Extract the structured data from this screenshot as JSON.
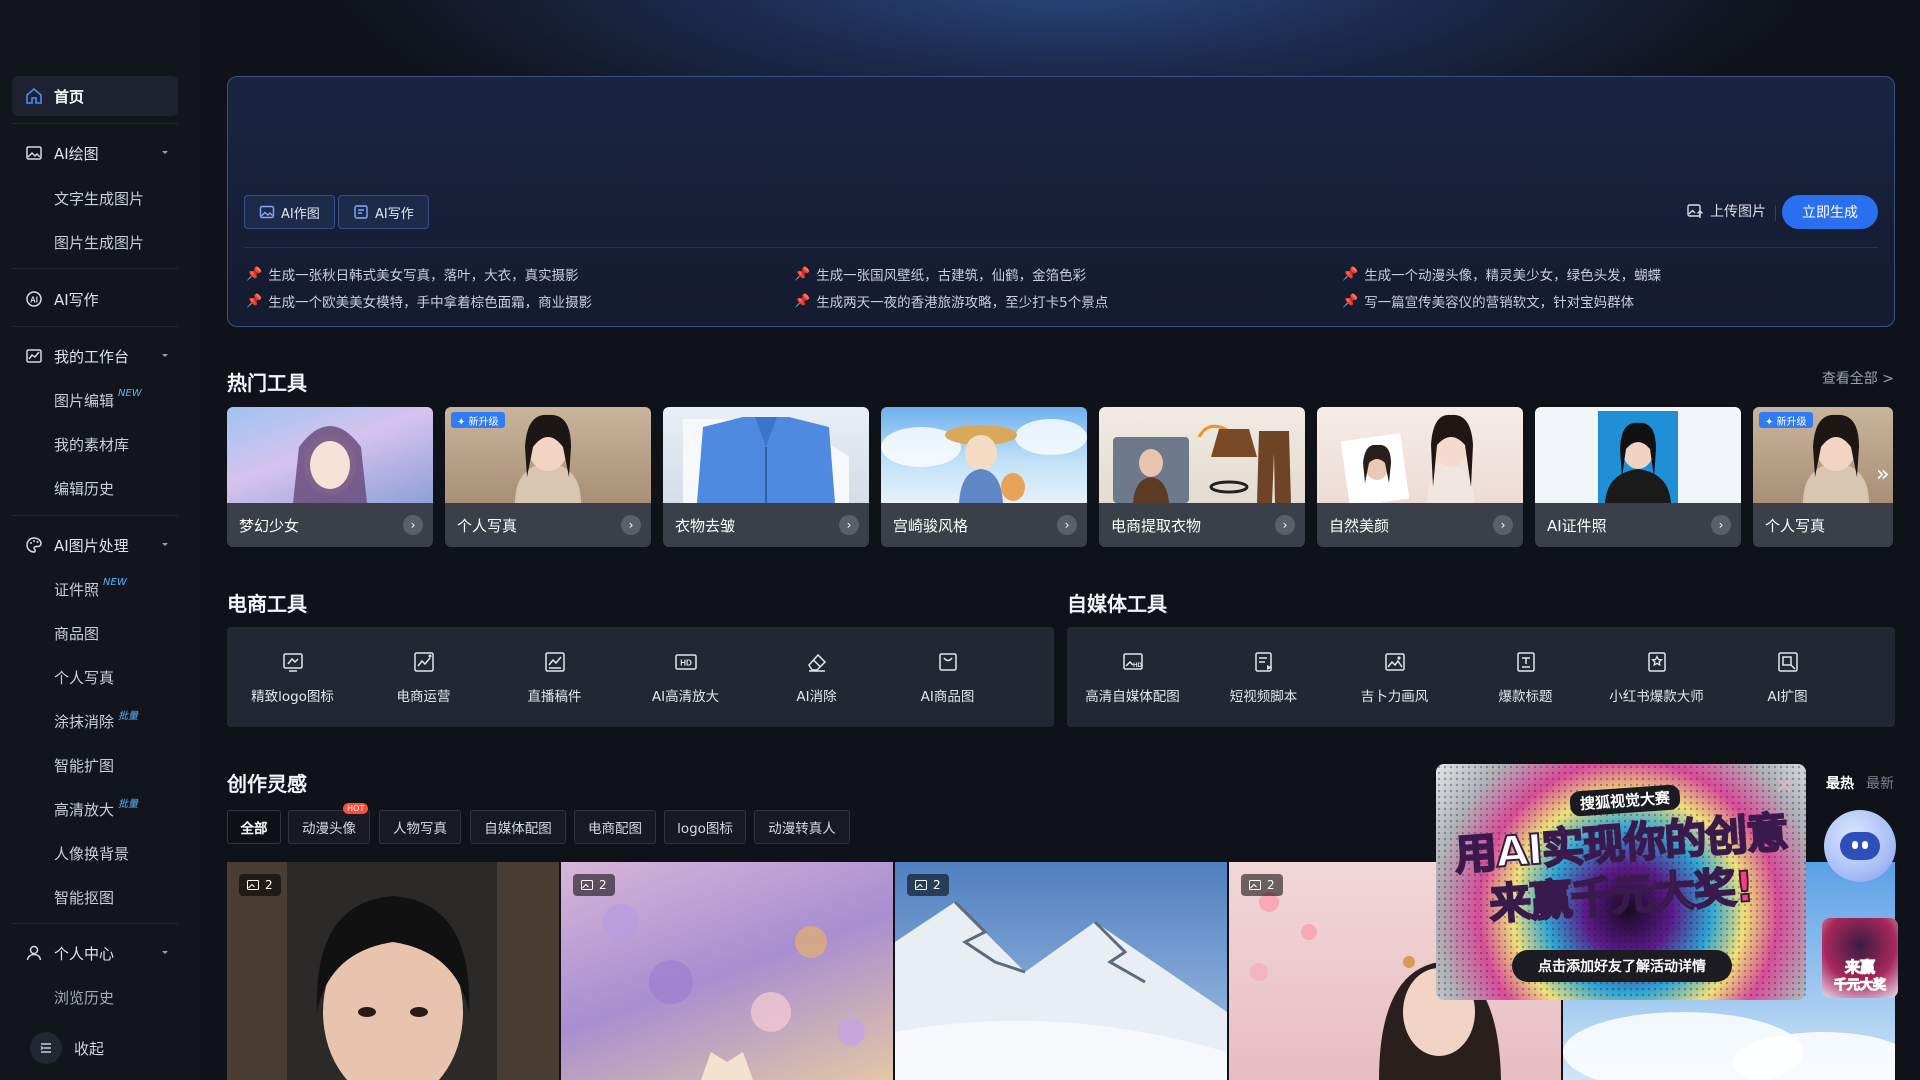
{
  "sidebar": {
    "home": "首页",
    "ai_draw": "AI绘图",
    "ai_draw_items": [
      "文字生成图片",
      "图片生成图片"
    ],
    "ai_write": "AI写作",
    "workbench": "我的工作台",
    "workbench_items": [
      "图片编辑",
      "我的素材库",
      "编辑历史"
    ],
    "image_edit_badge": "NEW",
    "ai_image_process": "AI图片处理",
    "process_items": [
      "证件照",
      "商品图",
      "个人写真",
      "涂抹消除",
      "智能扩图",
      "高清放大",
      "人像换背景",
      "智能抠图"
    ],
    "id_photo_badge": "NEW",
    "erase_badge": "批量",
    "upscale_badge": "批量",
    "personal_center": "个人中心",
    "browse_history": "浏览历史",
    "collapse": "收起"
  },
  "prompt_panel": {
    "mode_draw": "AI作图",
    "mode_write": "AI写作",
    "upload": "上传图片",
    "generate": "立即生成",
    "suggestions": [
      "生成一张秋日韩式美女写真，落叶，大衣，真实摄影",
      "生成一张国风壁纸，古建筑，仙鹤，金箔色彩",
      "生成一个动漫头像，精灵美少女，绿色头发，蝴蝶",
      "生成一个欧美美女模特，手中拿着棕色面霜，商业摄影",
      "生成两天一夜的香港旅游攻略，至少打卡5个景点",
      "写一篇宣传美容仪的营销软文，针对宝妈群体"
    ]
  },
  "hot_tools": {
    "title": "热门工具",
    "see_all": "查看全部 >",
    "upgrade_tag": "✦ 新升级",
    "cards": [
      "梦幻少女",
      "个人写真",
      "衣物去皱",
      "宫崎骏风格",
      "电商提取衣物",
      "自然美颜",
      "AI证件照",
      "个人写真"
    ]
  },
  "ecommerce_tools": {
    "title": "电商工具",
    "items": [
      "精致logo图标",
      "电商运营",
      "直播稿件",
      "AI高清放大",
      "AI消除",
      "AI商品图"
    ]
  },
  "media_tools": {
    "title": "自媒体工具",
    "items": [
      "高清自媒体配图",
      "短视频脚本",
      "吉卜力画风",
      "爆款标题",
      "小红书爆款大师",
      "AI扩图"
    ]
  },
  "inspiration": {
    "title": "创作灵感",
    "filters": [
      "全部",
      "动漫头像",
      "人物写真",
      "自媒体配图",
      "电商配图",
      "logo图标",
      "动漫转真人"
    ],
    "hot_badge": "HOT",
    "sort_hot": "最热",
    "sort_new": "最新",
    "gallery_counts": [
      "2",
      "2",
      "2",
      "2"
    ]
  },
  "promo": {
    "small": "搜狐视觉大赛",
    "line1": "用AI实现你的创意",
    "line2_a": "来赢",
    "line2_b": "千元大奖!",
    "cta": "点击添加好友了解活动详情",
    "side_1": "来赢",
    "side_2": "千元大奖"
  },
  "colors": {
    "accent": "#2a6ff0",
    "bg": "#0f1219",
    "panel": "#232733"
  }
}
